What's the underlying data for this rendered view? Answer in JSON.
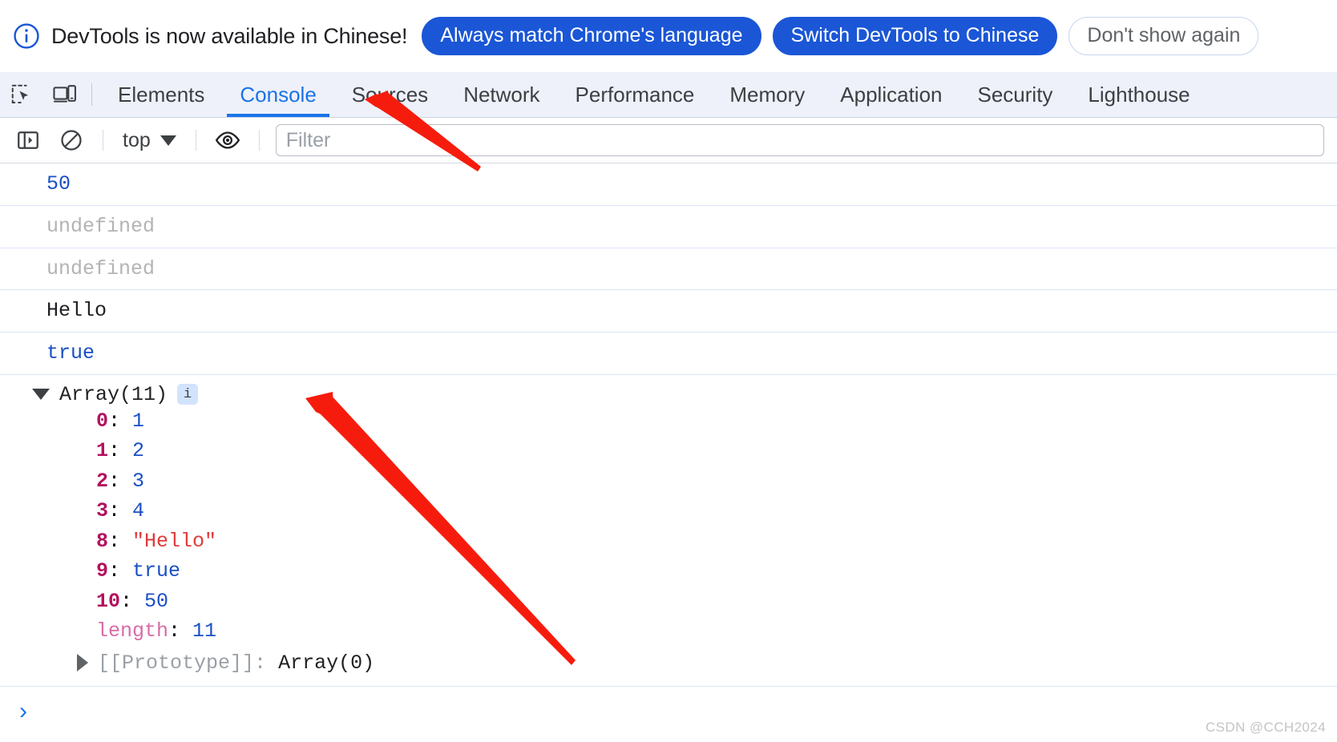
{
  "banner": {
    "icon": "info-circle-icon",
    "message": "DevTools is now available in Chinese!",
    "buttons": [
      {
        "label": "Always match Chrome's language",
        "style": "primary"
      },
      {
        "label": "Switch DevTools to Chinese",
        "style": "primary"
      },
      {
        "label": "Don't show again",
        "style": "ghost"
      }
    ],
    "accent_color": "#1a56d6"
  },
  "tab_bar": {
    "icons": [
      {
        "name": "inspect-element-icon"
      },
      {
        "name": "device-toolbar-icon"
      }
    ],
    "tabs": [
      {
        "label": "Elements",
        "active": false
      },
      {
        "label": "Console",
        "active": true
      },
      {
        "label": "Sources",
        "active": false
      },
      {
        "label": "Network",
        "active": false
      },
      {
        "label": "Performance",
        "active": false
      },
      {
        "label": "Memory",
        "active": false
      },
      {
        "label": "Application",
        "active": false
      },
      {
        "label": "Security",
        "active": false
      },
      {
        "label": "Lighthouse",
        "active": false
      }
    ],
    "active_color": "#1a73e8",
    "background": "#eef1fa"
  },
  "console_toolbar": {
    "sidebar_toggle_icon": "console-sidebar-icon",
    "clear_console_icon": "clear-console-icon",
    "context_selector": "top",
    "eye_icon": "live-expression-eye-icon",
    "filter_placeholder": "Filter",
    "filter_value": ""
  },
  "console": {
    "entries": [
      {
        "type": "number",
        "text": "50"
      },
      {
        "type": "undefined",
        "text": "undefined"
      },
      {
        "type": "undefined",
        "text": "undefined"
      },
      {
        "type": "string-plain",
        "text": "Hello"
      },
      {
        "type": "boolean",
        "text": "true"
      }
    ],
    "array_group": {
      "expanded": true,
      "title": "Array(11)",
      "info_badge": "i",
      "properties": [
        {
          "key": "0",
          "sep": ": ",
          "value": "1",
          "value_type": "number",
          "key_style": "index"
        },
        {
          "key": "1",
          "sep": ": ",
          "value": "2",
          "value_type": "number",
          "key_style": "index"
        },
        {
          "key": "2",
          "sep": ": ",
          "value": "3",
          "value_type": "number",
          "key_style": "index"
        },
        {
          "key": "3",
          "sep": ": ",
          "value": "4",
          "value_type": "number",
          "key_style": "index"
        },
        {
          "key": "8",
          "sep": ": ",
          "value": "\"Hello\"",
          "value_type": "string",
          "key_style": "index"
        },
        {
          "key": "9",
          "sep": ": ",
          "value": "true",
          "value_type": "boolean",
          "key_style": "index"
        },
        {
          "key": "10",
          "sep": ": ",
          "value": "50",
          "value_type": "number",
          "key_style": "index"
        },
        {
          "key": "length",
          "sep": ": ",
          "value": "11",
          "value_type": "number",
          "key_style": "builtin"
        }
      ],
      "prototype": {
        "expanded": false,
        "key": "[[Prototype]]",
        "sep": ": ",
        "value": "Array(0)"
      }
    },
    "prompt_symbol": "›"
  },
  "annotations": {
    "arrow_color": "#f61c0d",
    "arrows": [
      {
        "name": "arrow-to-console-tab",
        "points_to": "Console"
      },
      {
        "name": "arrow-to-array-group",
        "points_to": "Array(11)"
      }
    ]
  },
  "watermark": {
    "text": "CSDN @CCH2024"
  }
}
